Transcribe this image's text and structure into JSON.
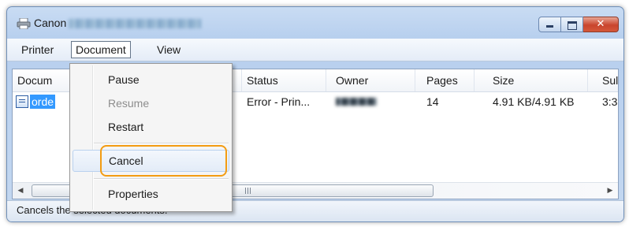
{
  "window": {
    "title": "Canon",
    "title_obscured": true,
    "icon": "printer-icon",
    "buttons": {
      "minimize": "minimize-icon",
      "maximize": "maximize-icon",
      "close": "close-icon"
    }
  },
  "menubar": {
    "items": [
      {
        "label": "Printer"
      },
      {
        "label": "Document",
        "active": true
      },
      {
        "label": "View"
      }
    ]
  },
  "table": {
    "columns": [
      "Document Name",
      "Status",
      "Owner",
      "Pages",
      "Size",
      "Submitted"
    ],
    "visible_headers": {
      "document": "Docum",
      "status": "Status",
      "owner": "Owner",
      "pages": "Pages",
      "size": "Size",
      "submitted": "Sul"
    },
    "rows": [
      {
        "document": "orde",
        "status": "Error - Prin...",
        "owner_obscured": true,
        "pages": "14",
        "size": "4.91 KB/4.91 KB",
        "submitted": "3:3"
      }
    ]
  },
  "context_menu": {
    "items": [
      {
        "label": "Pause",
        "enabled": true
      },
      {
        "label": "Resume",
        "enabled": false
      },
      {
        "label": "Restart",
        "enabled": true
      },
      {
        "label": "Cancel",
        "enabled": true,
        "highlighted": true
      },
      {
        "label": "Properties",
        "enabled": true
      }
    ]
  },
  "statusbar": {
    "text": "Cancels the selected documents."
  },
  "colors": {
    "highlight_ring": "#f39c12",
    "selection": "#3399ff",
    "close_button": "#c9452d"
  }
}
